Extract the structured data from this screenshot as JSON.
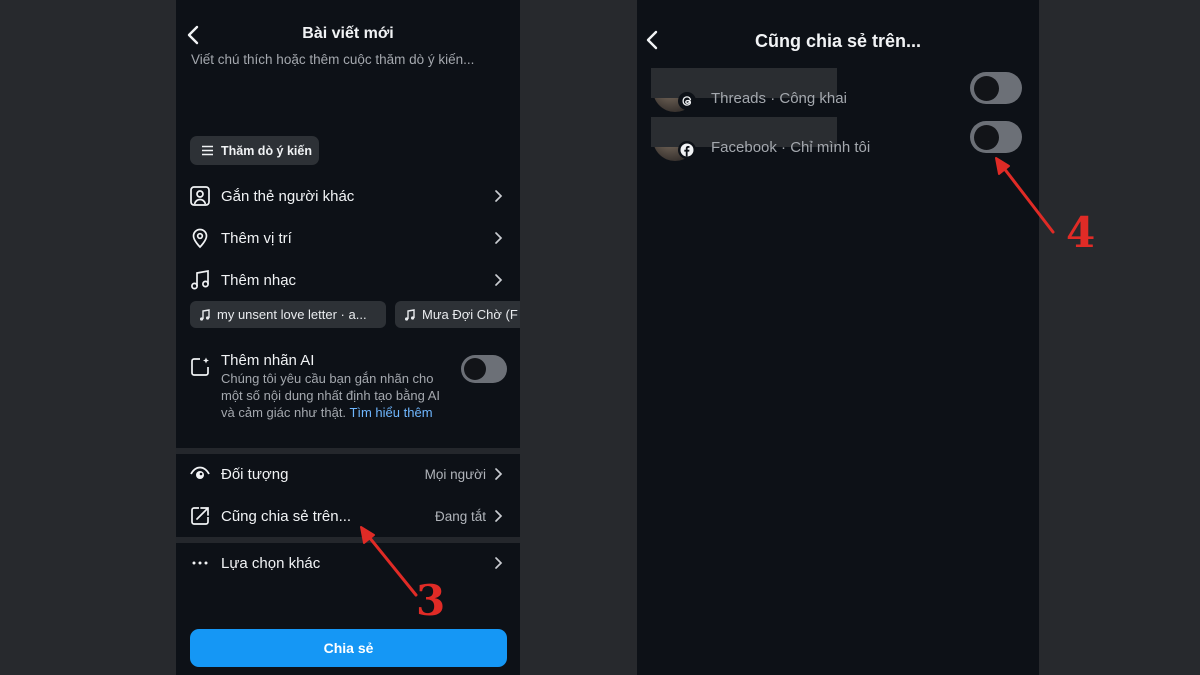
{
  "left_screen": {
    "title": "Bài viết mới",
    "caption_placeholder": "Viết chú thích hoặc thêm cuộc thăm dò ý kiến...",
    "poll_button": "Thăm dò ý kiến",
    "rows": {
      "tag_people": "Gắn thẻ người khác",
      "add_location": "Thêm vị trí",
      "add_music": "Thêm nhạc",
      "audience": "Đối tượng",
      "audience_value": "Mọi người",
      "also_share": "Cũng chia sẻ trên...",
      "also_share_value": "Đang tắt",
      "more_options": "Lựa chọn khác"
    },
    "music_chips": [
      "my unsent love letter · a...",
      "Mưa Đợi Chờ (F"
    ],
    "ai_label": {
      "title": "Thêm nhãn AI",
      "description": "Chúng tôi yêu cầu bạn gắn nhãn cho một số nội dung nhất định tạo bằng AI và cảm giác như thật.",
      "link_text": "Tìm hiểu thêm",
      "toggle_on": false
    },
    "share_button": "Chia sẻ"
  },
  "right_screen": {
    "title": "Cũng chia sẻ trên...",
    "accounts": [
      {
        "label": "Threads · Công khai",
        "badge_icon": "threads-icon",
        "toggle_on": false
      },
      {
        "label": "Facebook · Chỉ mình tôi",
        "badge_icon": "facebook-icon",
        "toggle_on": false
      }
    ]
  },
  "annotations": {
    "step_3": "3",
    "step_4": "4",
    "color": "#e02b26"
  },
  "colors": {
    "accent": "#1597f5",
    "background": "#0d1117",
    "link": "#6fb7ff"
  }
}
